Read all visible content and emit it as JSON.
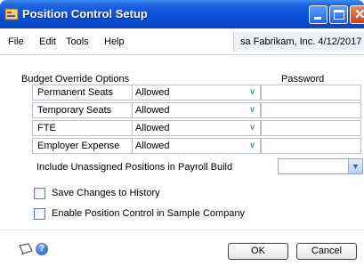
{
  "window": {
    "title": "Position Control Setup"
  },
  "menu": {
    "file": "File",
    "edit": "Edit",
    "tools": "Tools",
    "help": "Help"
  },
  "user_info": "sa  Fabrikam, Inc.  4/12/2017",
  "budget": {
    "section_label": "Budget Override Options",
    "password_header": "Password",
    "rows": [
      {
        "label": "Permanent Seats",
        "value": "Allowed"
      },
      {
        "label": "Temporary Seats",
        "value": "Allowed"
      },
      {
        "label": "FTE",
        "value": "Allowed"
      },
      {
        "label": "Employer Expense",
        "value": "Allowed"
      }
    ]
  },
  "include_unassigned": {
    "label": "Include Unassigned Positions in Payroll Build",
    "value": ""
  },
  "checkboxes": [
    {
      "label": "Save Changes to History",
      "checked": false
    },
    {
      "label": "Enable Position Control in Sample Company",
      "checked": false
    }
  ],
  "buttons": {
    "ok": "OK",
    "cancel": "Cancel"
  },
  "icons": {
    "app": "window-app-icon",
    "note": "note-icon",
    "help": "help-icon"
  },
  "colors": {
    "titlebar": "#0a4fd6",
    "accent": "#3a6fd0"
  }
}
